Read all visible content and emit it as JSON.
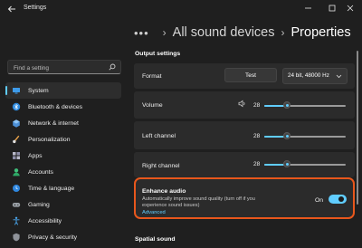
{
  "window": {
    "title": "Settings"
  },
  "search": {
    "placeholder": "Find a setting"
  },
  "sidebar": {
    "items": [
      {
        "label": "System",
        "icon": "system-icon",
        "active": true
      },
      {
        "label": "Bluetooth & devices",
        "icon": "bluetooth-icon"
      },
      {
        "label": "Network & internet",
        "icon": "network-icon"
      },
      {
        "label": "Personalization",
        "icon": "personalization-icon"
      },
      {
        "label": "Apps",
        "icon": "apps-icon"
      },
      {
        "label": "Accounts",
        "icon": "accounts-icon"
      },
      {
        "label": "Time & language",
        "icon": "time-language-icon"
      },
      {
        "label": "Gaming",
        "icon": "gaming-icon"
      },
      {
        "label": "Accessibility",
        "icon": "accessibility-icon"
      },
      {
        "label": "Privacy & security",
        "icon": "privacy-icon"
      }
    ]
  },
  "breadcrumb": {
    "more": "•••",
    "parent": "All sound devices",
    "current": "Properties"
  },
  "output": {
    "section_title": "Output settings",
    "format_label": "Format",
    "test_label": "Test",
    "format_value": "24 bit, 48000 Hz",
    "volume": {
      "label": "Volume",
      "value": "28",
      "fraction": 0.28
    },
    "left": {
      "label": "Left channel",
      "value": "28",
      "fraction": 0.28
    },
    "right": {
      "label": "Right channel",
      "value": "28",
      "fraction": 0.28
    }
  },
  "enhance": {
    "title": "Enhance audio",
    "description": "Automatically improve sound quality (turn off if you experience sound issues)",
    "link": "Advanced",
    "state_label": "On",
    "on": true
  },
  "spatial": {
    "section_title": "Spatial sound"
  },
  "colors": {
    "accent": "#60cdff",
    "highlight_border": "#e8571c",
    "background": "#202020"
  }
}
